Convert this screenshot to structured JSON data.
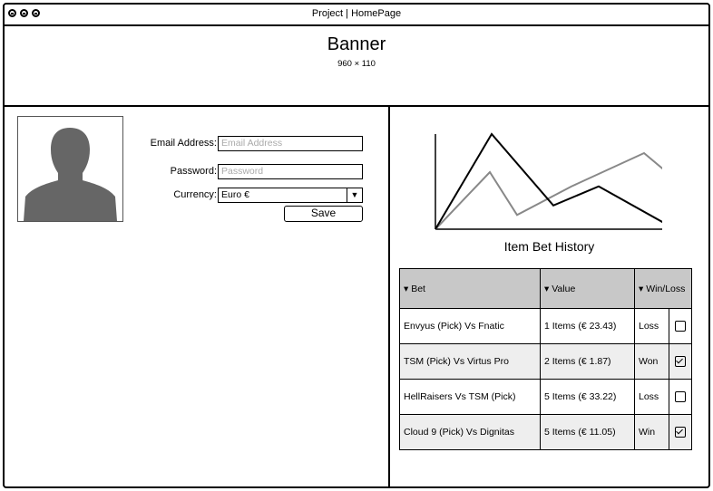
{
  "window": {
    "title": "Project | HomePage"
  },
  "banner": {
    "title": "Banner",
    "size": "960 × 110"
  },
  "form": {
    "email_label": "Email Address:",
    "email_placeholder": "Email Address",
    "password_label": "Password:",
    "password_placeholder": "Password",
    "currency_label": "Currency:",
    "currency_value": "Euro €",
    "save_label": "Save"
  },
  "chart": {
    "caption": "Item Bet History",
    "chart_data": {
      "type": "line",
      "title": "Item Bet History",
      "x": [
        0,
        1,
        2,
        3,
        4
      ],
      "series": [
        {
          "values": [
            0,
            100,
            25,
            45,
            5
          ],
          "color": "#000000"
        },
        {
          "values": [
            0,
            60,
            15,
            45,
            80,
            60
          ],
          "color": "#888888"
        }
      ]
    }
  },
  "table": {
    "headers": [
      "Bet",
      "Value",
      "Win/Loss"
    ],
    "rows": [
      {
        "bet": "Envyus (Pick) Vs Fnatic",
        "value": "1 Items (€ 23.43)",
        "result": "Loss",
        "checked": false
      },
      {
        "bet": "TSM (Pick) Vs Virtus Pro",
        "value": "2 Items (€ 1.87)",
        "result": "Won",
        "checked": true
      },
      {
        "bet": "HellRaisers Vs TSM (Pick)",
        "value": "5 Items (€ 33.22)",
        "result": "Loss",
        "checked": false
      },
      {
        "bet": "Cloud 9 (Pick) Vs Dignitas",
        "value": "5 Items (€ 11.05)",
        "result": "Win",
        "checked": true
      }
    ]
  }
}
